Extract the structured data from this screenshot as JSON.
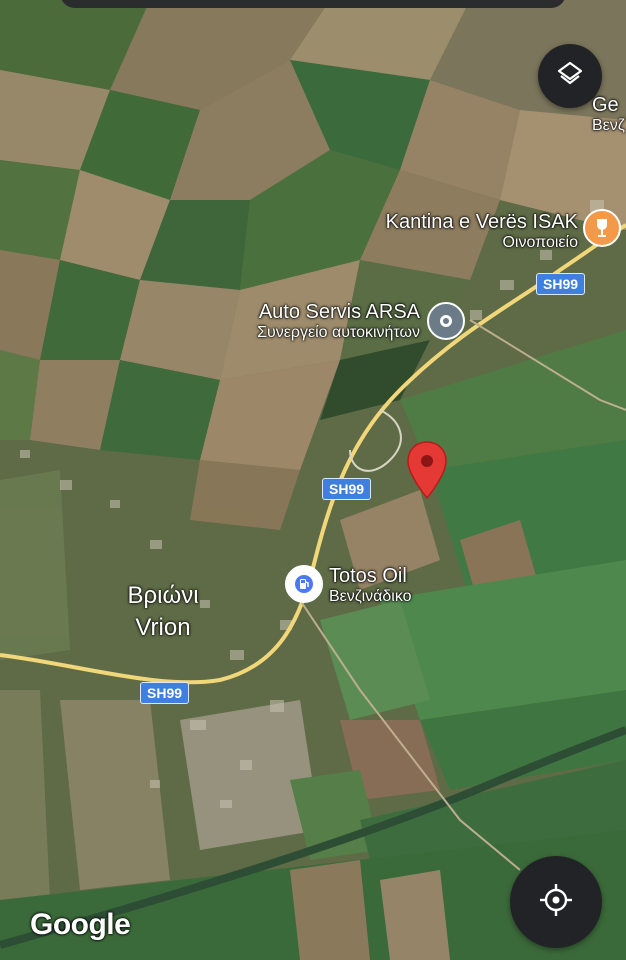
{
  "map": {
    "roads": [
      "SH99",
      "SH99",
      "SH99"
    ],
    "pois": [
      {
        "name": "Kantina e Verës ISAK",
        "subtitle": "Οινοποιείο",
        "icon": "wine-glass-icon",
        "color": "#f2994a"
      },
      {
        "name": "Auto Servis ARSA",
        "subtitle": "Συνεργείο αυτοκινήτων",
        "icon": "pin-dot-icon",
        "color": "#6b7c88"
      },
      {
        "name": "Totos Oil",
        "subtitle": "Βενζινάδικο",
        "icon": "gas-station-icon",
        "color": "#4a79f5"
      }
    ],
    "partial_poi": {
      "name": "Ge",
      "subtitle": "Βενζ"
    },
    "town": {
      "name_greek": "Βριώνι",
      "name_latin": "Vrion"
    },
    "selected_pin": {
      "icon": "red-pin-icon",
      "color": "#e53935"
    },
    "attribution": "Google"
  },
  "controls": {
    "layers_icon": "layers-icon",
    "locate_icon": "my-location-icon"
  }
}
